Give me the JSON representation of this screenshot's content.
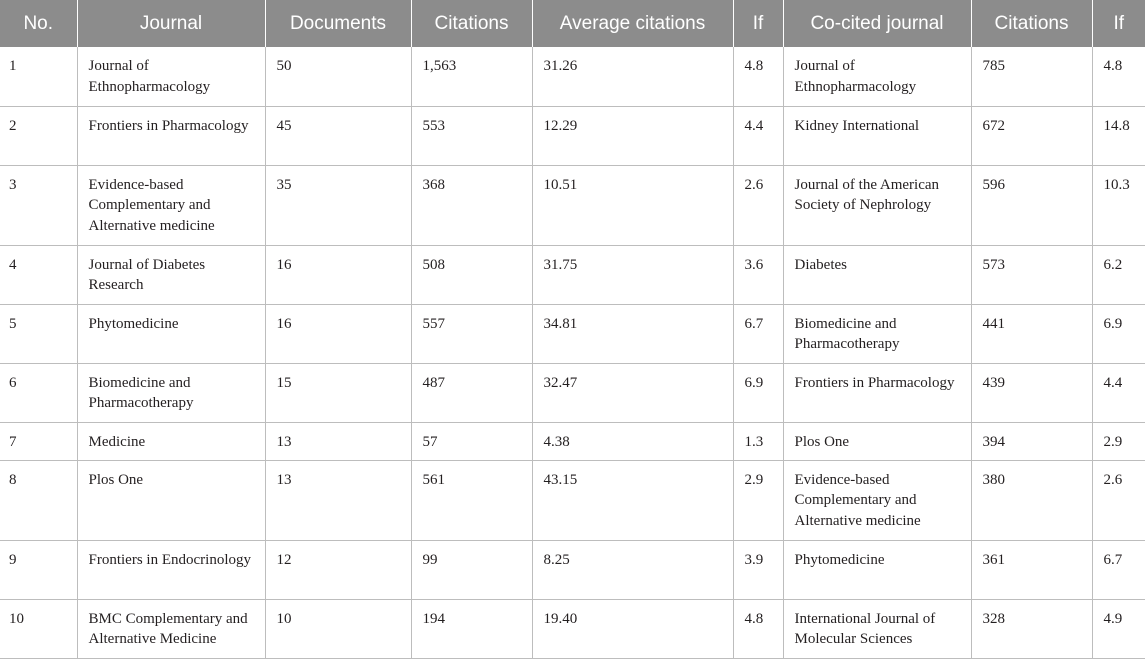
{
  "columns": [
    "No.",
    "Journal",
    "Documents",
    "Citations",
    "Average citations",
    "If",
    "Co-cited journal",
    "Citations",
    "If"
  ],
  "rows": [
    [
      "1",
      "Journal of Ethnopharmacology",
      "50",
      "1,563",
      "31.26",
      "4.8",
      "Journal of Ethnopharmacology",
      "785",
      "4.8"
    ],
    [
      "2",
      "Frontiers in Pharmacology",
      "45",
      "553",
      "12.29",
      "4.4",
      "Kidney International",
      "672",
      "14.8"
    ],
    [
      "3",
      "Evidence-based Complementary and Alternative medicine",
      "35",
      "368",
      "10.51",
      "2.6",
      "Journal of the American Society of Nephrology",
      "596",
      "10.3"
    ],
    [
      "4",
      "Journal of Diabetes Research",
      "16",
      "508",
      "31.75",
      "3.6",
      "Diabetes",
      "573",
      "6.2"
    ],
    [
      "5",
      "Phytomedicine",
      "16",
      "557",
      "34.81",
      "6.7",
      "Biomedicine and Pharmacotherapy",
      "441",
      "6.9"
    ],
    [
      "6",
      "Biomedicine and Pharmacotherapy",
      "15",
      "487",
      "32.47",
      "6.9",
      "Frontiers in Pharmacology",
      "439",
      "4.4"
    ],
    [
      "7",
      "Medicine",
      "13",
      "57",
      "4.38",
      "1.3",
      "Plos One",
      "394",
      "2.9"
    ],
    [
      "8",
      "Plos One",
      "13",
      "561",
      "43.15",
      "2.9",
      "Evidence-based Complementary and Alternative medicine",
      "380",
      "2.6"
    ],
    [
      "9",
      "Frontiers in Endocrinology",
      "12",
      "99",
      "8.25",
      "3.9",
      "Phytomedicine",
      "361",
      "6.7"
    ],
    [
      "10",
      "BMC Complementary and Alternative Medicine",
      "10",
      "194",
      "19.40",
      "4.8",
      "International Journal of Molecular Sciences",
      "328",
      "4.9"
    ]
  ]
}
